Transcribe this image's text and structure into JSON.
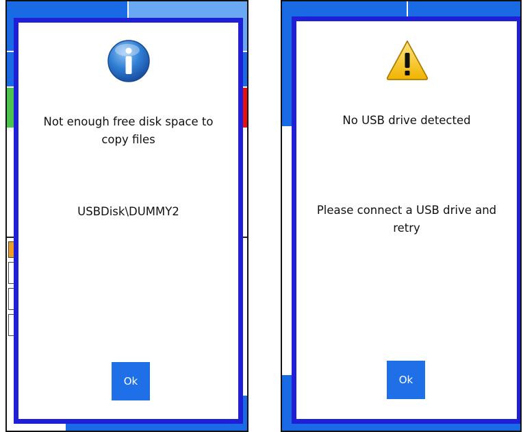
{
  "left_dialog": {
    "icon": "info-icon",
    "message": "Not enough free disk space to copy files",
    "path": "USBDisk\\DUMMY2",
    "ok_label": "Ok"
  },
  "right_dialog": {
    "icon": "warning-icon",
    "title": "No USB drive detected",
    "message": "Please connect a USB drive and retry",
    "ok_label": "Ok"
  },
  "colors": {
    "dialog_border": "#1f1fd8",
    "button": "#1f6fe8",
    "background_blue": "#1a6ae6",
    "light_blue": "#6aa8f4",
    "green_tab": "#4cc44c",
    "red_tab": "#e81010"
  }
}
